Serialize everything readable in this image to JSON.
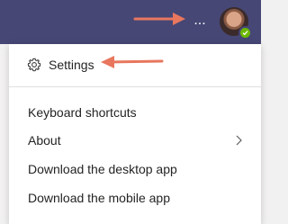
{
  "topbar": {
    "more_options_label": "...",
    "accent_color": "#464775",
    "presence_color": "#6bb700"
  },
  "menu": {
    "settings_label": "Settings",
    "items": [
      {
        "label": "Keyboard shortcuts"
      },
      {
        "label": "About",
        "has_submenu": true
      },
      {
        "label": "Download the desktop app"
      },
      {
        "label": "Download the mobile app"
      }
    ]
  },
  "annotation": {
    "arrow_color": "#e8775e"
  }
}
